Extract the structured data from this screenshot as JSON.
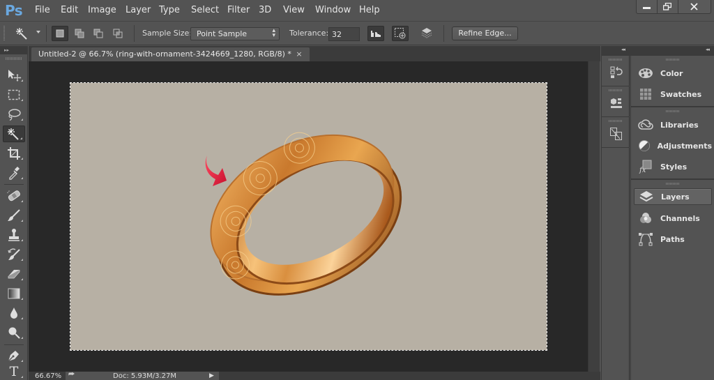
{
  "app": {
    "logo": "Ps",
    "brand_color": "#6aa8e0"
  },
  "menu": [
    "File",
    "Edit",
    "Image",
    "Layer",
    "Type",
    "Select",
    "Filter",
    "3D",
    "View",
    "Window",
    "Help"
  ],
  "window_controls": {
    "minimize": "minimize-icon",
    "restore": "restore-icon",
    "close": "close-icon"
  },
  "options_bar": {
    "tool": "magic-wand-icon",
    "selection_modes": [
      "new-selection",
      "add-to-selection",
      "subtract-from-selection",
      "intersect-with-selection"
    ],
    "active_mode": "new-selection",
    "sample_size_label": "Sample Size:",
    "sample_size_value": "Point Sample",
    "tolerance_label": "Tolerance:",
    "tolerance_value": "32",
    "anti_alias": true,
    "contiguous": true,
    "refine_edge_label": "Refine Edge..."
  },
  "document": {
    "tab_title": "Untitled-2 @ 66.7% (ring-with-ornament-3424669_1280, RGB/8) *",
    "tab_close": "×",
    "canvas_color": "#b7b0a4",
    "marquee_active": true
  },
  "status_bar": {
    "zoom": "66.67%",
    "doc_size": "Doc: 5.93M/3.27M"
  },
  "tools": [
    {
      "name": "move-tool",
      "active": false
    },
    {
      "name": "rectangular-marquee-tool",
      "active": false
    },
    {
      "name": "lasso-tool",
      "active": false
    },
    {
      "name": "magic-wand-tool",
      "active": true
    },
    {
      "name": "crop-tool",
      "active": false
    },
    {
      "name": "eyedropper-tool",
      "active": false
    },
    {
      "name": "spot-healing-brush-tool",
      "active": false
    },
    {
      "name": "brush-tool",
      "active": false
    },
    {
      "name": "clone-stamp-tool",
      "active": false
    },
    {
      "name": "history-brush-tool",
      "active": false
    },
    {
      "name": "eraser-tool",
      "active": false
    },
    {
      "name": "gradient-tool",
      "active": false
    },
    {
      "name": "blur-tool",
      "active": false
    },
    {
      "name": "dodge-tool",
      "active": false
    },
    {
      "name": "pen-tool",
      "active": false
    },
    {
      "name": "type-tool",
      "active": false
    }
  ],
  "dock_icons": [
    "history-icon",
    "properties-icon",
    "navigator-icon"
  ],
  "panels": {
    "group1": [
      {
        "label": "Color",
        "icon": "palette-icon"
      },
      {
        "label": "Swatches",
        "icon": "swatches-icon"
      }
    ],
    "group2": [
      {
        "label": "Libraries",
        "icon": "libraries-icon"
      },
      {
        "label": "Adjustments",
        "icon": "adjustments-icon"
      },
      {
        "label": "Styles",
        "icon": "styles-icon"
      }
    ],
    "group3": [
      {
        "label": "Layers",
        "icon": "layers-icon",
        "active": true
      },
      {
        "label": "Channels",
        "icon": "channels-icon"
      },
      {
        "label": "Paths",
        "icon": "paths-icon"
      }
    ]
  }
}
